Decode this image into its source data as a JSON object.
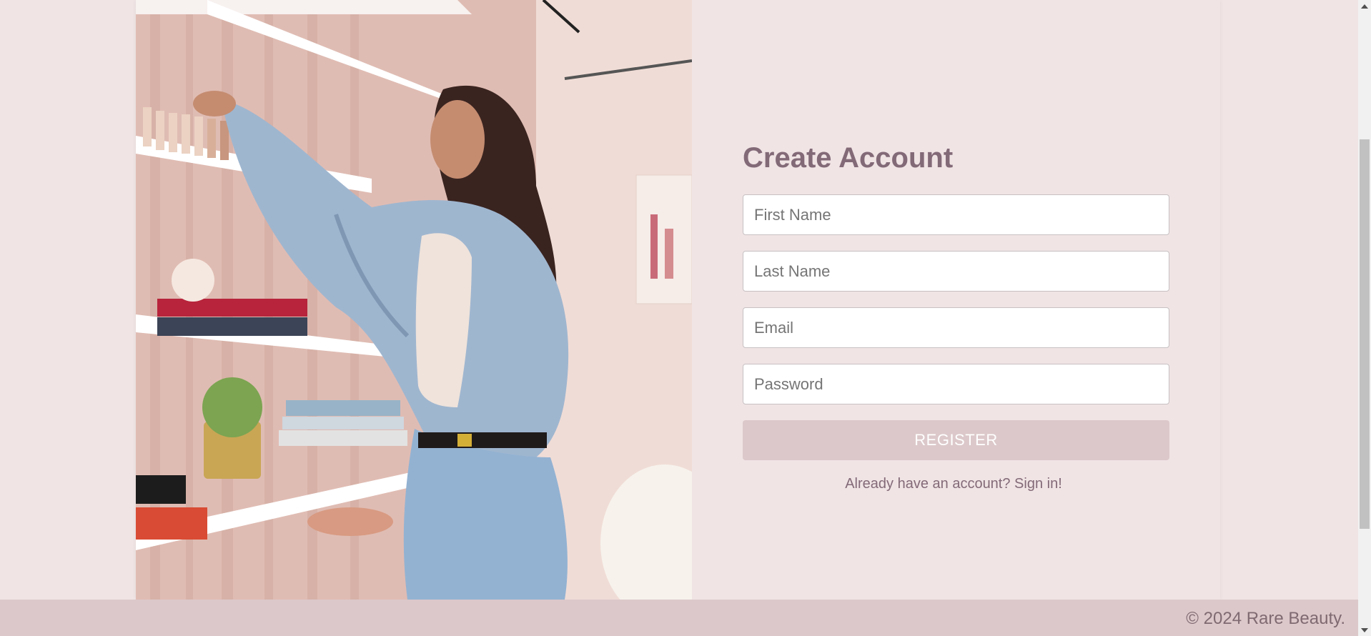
{
  "form": {
    "title": "Create Account",
    "fields": {
      "first_name_placeholder": "First Name",
      "last_name_placeholder": "Last Name",
      "email_placeholder": "Email",
      "password_placeholder": "Password"
    },
    "register_label": "REGISTER",
    "signin_text": "Already have an account? Sign in!"
  },
  "footer": {
    "copyright": "© 2024 Rare Beauty."
  },
  "colors": {
    "background": "#f0e4e5",
    "accent": "#836a77",
    "button": "#dcc8ca",
    "footer": "#dcc8ca"
  },
  "photo": {
    "subject": "model-with-shelf-icon"
  }
}
